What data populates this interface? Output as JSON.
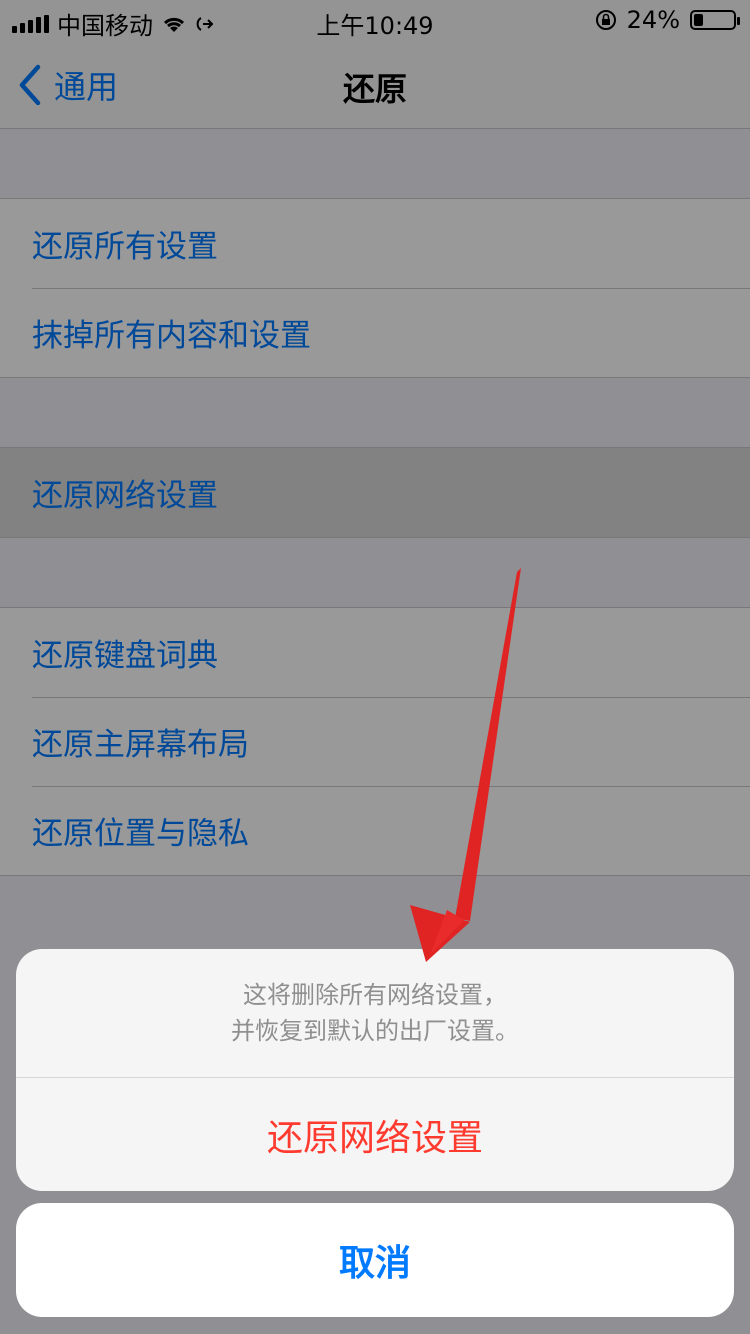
{
  "status_bar": {
    "carrier": "中国移动",
    "time": "上午10:49",
    "battery_percent": "24%",
    "battery_level": 0.24,
    "icons": [
      "signal-icon",
      "wifi-icon",
      "call-forwarding-icon",
      "rotation-lock-icon",
      "battery-icon"
    ]
  },
  "nav": {
    "back_label": "通用",
    "title": "还原"
  },
  "groups": [
    {
      "items": [
        {
          "label": "还原所有设置"
        },
        {
          "label": "抹掉所有内容和设置"
        }
      ]
    },
    {
      "items": [
        {
          "label": "还原网络设置",
          "highlighted": true
        }
      ]
    },
    {
      "items": [
        {
          "label": "还原键盘词典"
        },
        {
          "label": "还原主屏幕布局"
        },
        {
          "label": "还原位置与隐私"
        }
      ]
    }
  ],
  "action_sheet": {
    "message_line1": "这将删除所有网络设置，",
    "message_line2": "并恢复到默认的出厂设置。",
    "destructive_label": "还原网络设置",
    "cancel_label": "取消"
  },
  "colors": {
    "accent": "#007aff",
    "destructive": "#ff3b30",
    "annotation_arrow": "#e02424"
  }
}
